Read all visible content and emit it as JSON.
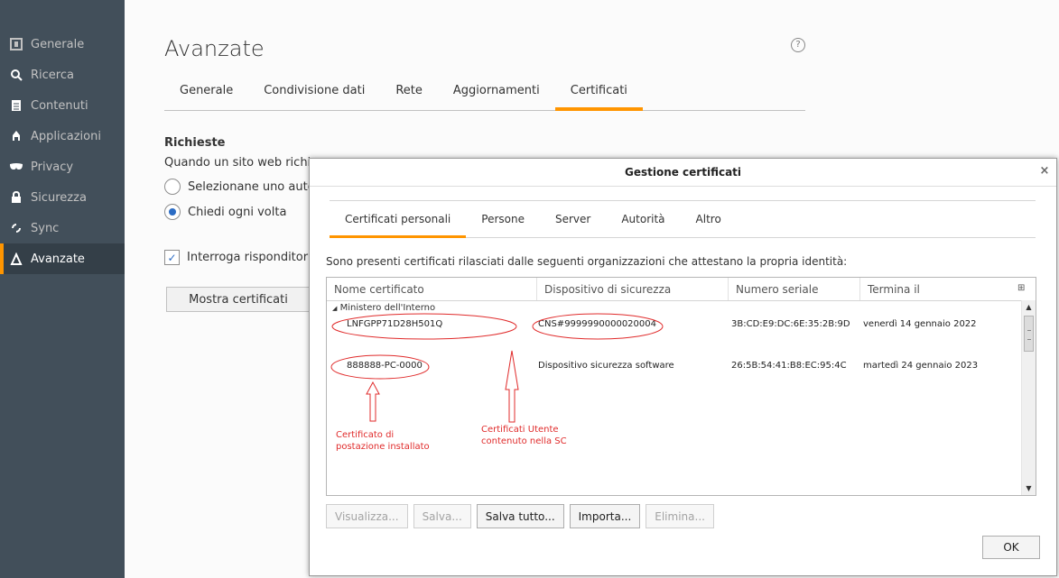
{
  "sidebar": {
    "items": [
      {
        "label": "Generale",
        "icon": "general-icon"
      },
      {
        "label": "Ricerca",
        "icon": "search-icon"
      },
      {
        "label": "Contenuti",
        "icon": "content-icon"
      },
      {
        "label": "Applicazioni",
        "icon": "applications-icon"
      },
      {
        "label": "Privacy",
        "icon": "privacy-mask-icon"
      },
      {
        "label": "Sicurezza",
        "icon": "security-icon"
      },
      {
        "label": "Sync",
        "icon": "sync-icon"
      },
      {
        "label": "Avanzate",
        "icon": "advanced-icon"
      }
    ],
    "selected": "Avanzate"
  },
  "main": {
    "title": "Avanzate",
    "tabs": [
      {
        "label": "Generale"
      },
      {
        "label": "Condivisione dati"
      },
      {
        "label": "Rete"
      },
      {
        "label": "Aggiornamenti"
      },
      {
        "label": "Certificati"
      }
    ],
    "selected_tab": "Certificati",
    "section_title": "Richieste",
    "section_desc": "Quando un sito web richiec",
    "radio_1": "Selezionane uno autor",
    "radio_2": "Chiedi ogni volta",
    "checkbox_label": "Interroga risponditori",
    "show_certs_button": "Mostra certificati"
  },
  "dialog": {
    "title": "Gestione certificati",
    "close_glyph": "×",
    "tabs": [
      {
        "label": "Certificati personali"
      },
      {
        "label": "Persone"
      },
      {
        "label": "Server"
      },
      {
        "label": "Autorità"
      },
      {
        "label": "Altro"
      }
    ],
    "selected_tab": "Certificati personali",
    "description": "Sono presenti certificati rilasciati dalle seguenti organizzazioni che attestano la propria identità:",
    "columns": {
      "name": "Nome certificato",
      "device": "Dispositivo di sicurezza",
      "serial": "Numero seriale",
      "expires": "Termina il"
    },
    "group": "Ministero dell'Interno",
    "rows": [
      {
        "name": "LNFGPP71D28H501Q",
        "device": "CNS#9999990000020004",
        "serial": "3B:CD:E9:DC:6E:35:2B:9D",
        "expires": "venerdì 14 gennaio 2022"
      },
      {
        "name": "888888-PC-0000",
        "device": "Dispositivo sicurezza software",
        "serial": "26:5B:54:41:B8:EC:95:4C",
        "expires": "martedì 24 gennaio 2023"
      }
    ],
    "annotations": {
      "left_line1": "Certificato di",
      "left_line2": "postazione installato",
      "right_line1": "Certificati Utente",
      "right_line2": "contenuto nella SC"
    },
    "buttons": {
      "view": "Visualizza...",
      "save": "Salva...",
      "save_all": "Salva tutto...",
      "import": "Importa...",
      "delete": "Elimina...",
      "ok": "OK"
    }
  }
}
